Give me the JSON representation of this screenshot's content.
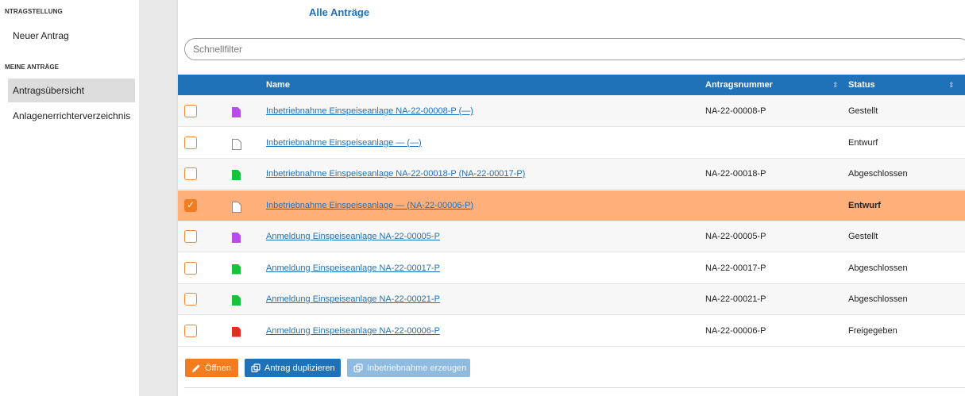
{
  "sidebar": {
    "sections": [
      {
        "title": "NTRAGSTELLUNG",
        "items": [
          {
            "label": "Neuer Antrag",
            "active": false
          }
        ]
      },
      {
        "title": "MEINE ANTRÄGE",
        "items": [
          {
            "label": "Antragsübersicht",
            "active": true
          },
          {
            "label": "Anlagenerrichterverzeichnis",
            "active": false
          }
        ]
      }
    ]
  },
  "main": {
    "title": "Alle Anträge",
    "filter": {
      "placeholder": "Schnellfilter",
      "value": ""
    }
  },
  "table": {
    "columns": [
      "Name",
      "Antragsnummer",
      "Status"
    ],
    "rows": [
      {
        "checked": false,
        "icon": "document-purple-icon",
        "icon_color": "#b44ee6",
        "name": "Inbetriebnahme Einspeiseanlage NA-22-00008-P (—)",
        "number": "NA-22-00008-P",
        "status": "Gestellt"
      },
      {
        "checked": false,
        "icon": "document-outline-icon",
        "icon_color": "#ffffff",
        "name": "Inbetriebnahme Einspeiseanlage — (—)",
        "number": "",
        "status": "Entwurf"
      },
      {
        "checked": false,
        "icon": "document-green-icon",
        "icon_color": "#19c23b",
        "name": "Inbetriebnahme Einspeiseanlage NA-22-00018-P (NA-22-00017-P)",
        "number": "NA-22-00018-P",
        "status": "Abgeschlossen"
      },
      {
        "checked": true,
        "icon": "document-outline-icon",
        "icon_color": "#ffffff",
        "name": "Inbetriebnahme Einspeiseanlage — (NA-22-00006-P)",
        "number": "",
        "status": "Entwurf"
      },
      {
        "checked": false,
        "icon": "document-purple-icon",
        "icon_color": "#b44ee6",
        "name": "Anmeldung Einspeiseanlage NA-22-00005-P",
        "number": "NA-22-00005-P",
        "status": "Gestellt"
      },
      {
        "checked": false,
        "icon": "document-green-icon",
        "icon_color": "#19c23b",
        "name": "Anmeldung Einspeiseanlage NA-22-00017-P",
        "number": "NA-22-00017-P",
        "status": "Abgeschlossen"
      },
      {
        "checked": false,
        "icon": "document-green-icon",
        "icon_color": "#19c23b",
        "name": "Anmeldung Einspeiseanlage NA-22-00021-P",
        "number": "NA-22-00021-P",
        "status": "Abgeschlossen"
      },
      {
        "checked": false,
        "icon": "document-red-icon",
        "icon_color": "#e0301e",
        "name": "Anmeldung Einspeiseanlage NA-22-00006-P",
        "number": "NA-22-00006-P",
        "status": "Freigegeben"
      }
    ]
  },
  "actions": {
    "open_label": "Öffnen",
    "duplicate_label": "Antrag duplizieren",
    "commission_label": "Inbetriebnahme erzeugen",
    "commission_disabled": true
  },
  "colors": {
    "primary": "#1f71b8",
    "accent": "#f47c20",
    "selected_row": "#ffaf7a",
    "disabled_button": "#8fbbe0"
  }
}
